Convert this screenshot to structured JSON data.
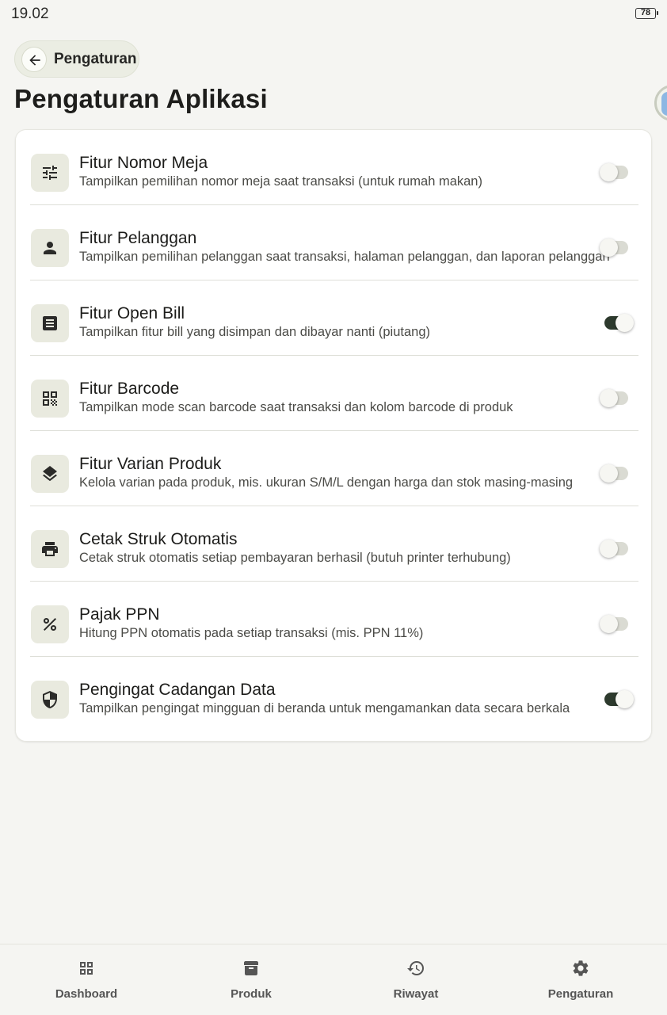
{
  "status_bar": {
    "time": "19.02",
    "battery": "78"
  },
  "header": {
    "back_label": "Pengaturan",
    "title": "Pengaturan Aplikasi"
  },
  "settings": [
    {
      "title": "Fitur Nomor Meja",
      "subtitle": "Tampilkan pemilihan nomor meja saat transaksi (untuk rumah makan)",
      "icon": "tune-icon",
      "enabled": false
    },
    {
      "title": "Fitur Pelanggan",
      "subtitle": "Tampilkan pemilihan pelanggan saat transaksi, halaman pelanggan, dan laporan pelanggan",
      "icon": "person-icon",
      "enabled": false
    },
    {
      "title": "Fitur Open Bill",
      "subtitle": "Tampilkan fitur bill yang disimpan dan dibayar nanti (piutang)",
      "icon": "receipt-icon",
      "enabled": true
    },
    {
      "title": "Fitur Barcode",
      "subtitle": "Tampilkan mode scan barcode saat transaksi dan kolom barcode di produk",
      "icon": "qr-code-icon",
      "enabled": false
    },
    {
      "title": "Fitur Varian Produk",
      "subtitle": "Kelola varian pada produk, mis. ukuran S/M/L dengan harga dan stok masing-masing",
      "icon": "layers-icon",
      "enabled": false
    },
    {
      "title": "Cetak Struk Otomatis",
      "subtitle": "Cetak struk otomatis setiap pembayaran berhasil (butuh printer terhubung)",
      "icon": "printer-icon",
      "enabled": false
    },
    {
      "title": "Pajak PPN",
      "subtitle": "Hitung PPN otomatis pada setiap transaksi (mis. PPN 11%)",
      "icon": "percent-icon",
      "enabled": false
    },
    {
      "title": "Pengingat Cadangan Data",
      "subtitle": "Tampilkan pengingat mingguan di beranda untuk mengamankan data secara berkala",
      "icon": "shield-icon",
      "enabled": true
    }
  ],
  "bottom_nav": [
    {
      "label": "Dashboard",
      "icon": "dashboard-icon"
    },
    {
      "label": "Produk",
      "icon": "archive-icon"
    },
    {
      "label": "Riwayat",
      "icon": "history-icon"
    },
    {
      "label": "Pengaturan",
      "icon": "gear-icon"
    }
  ],
  "colors": {
    "background": "#f5f5f2",
    "icon_tile": "#e9eadf",
    "toggle_on": "#2d3a2d",
    "toggle_off": "#dadbd3"
  }
}
